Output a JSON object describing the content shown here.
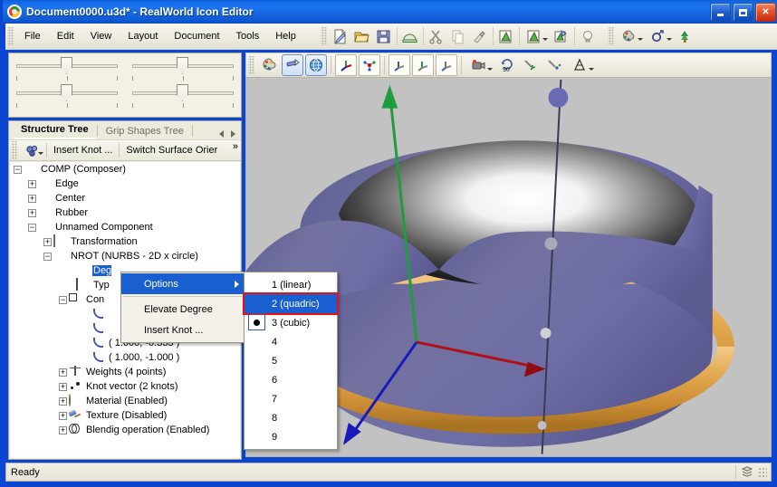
{
  "window": {
    "title": "Document0000.u3d* - RealWorld Icon Editor",
    "app_icon": "realworld-logo-icon",
    "minimize_label": "Minimize",
    "maximize_label": "Maximize",
    "close_label": "Close",
    "close_glyph": "✕"
  },
  "menubar": {
    "items": [
      {
        "label": "File"
      },
      {
        "label": "Edit"
      },
      {
        "label": "View"
      },
      {
        "label": "Layout"
      },
      {
        "label": "Document"
      },
      {
        "label": "Tools"
      },
      {
        "label": "Help"
      }
    ],
    "toolbar_icons": [
      {
        "name": "new-document-icon"
      },
      {
        "name": "open-folder-icon"
      },
      {
        "name": "save-disk-icon"
      },
      {
        "name": "export-icon"
      },
      {
        "name": "cut-scissors-icon"
      },
      {
        "name": "copy-icon"
      },
      {
        "name": "paste-brush-icon"
      },
      {
        "name": "new-image-icon"
      },
      {
        "name": "new-image-dropdown-icon"
      },
      {
        "name": "import-image-icon"
      },
      {
        "name": "lightbulb-icon"
      },
      {
        "name": "color-palette-dropdown-icon"
      },
      {
        "name": "add-object-dropdown-icon"
      },
      {
        "name": "tree-object-icon"
      }
    ]
  },
  "sliders": {
    "name": "view-rotation-sliders",
    "items": [
      {
        "name": "slider-top-left",
        "value": 50
      },
      {
        "name": "slider-top-right",
        "value": 50
      },
      {
        "name": "slider-bottom-left",
        "value": 50
      },
      {
        "name": "slider-bottom-right",
        "value": 50
      }
    ]
  },
  "treepane": {
    "tabs": [
      {
        "label": "Structure Tree",
        "active": true
      },
      {
        "label": "Grip Shapes Tree",
        "active": false
      }
    ],
    "nav_prev": "◁",
    "nav_next": "▷",
    "toolbar": {
      "dropdown_icon": "object-dropdown-icon",
      "buttons": [
        {
          "label": "Insert Knot ..."
        },
        {
          "label": "Switch Surface Orier"
        }
      ],
      "overflow": "»"
    },
    "rows": [
      {
        "indent": 0,
        "expander": "-",
        "icon": "composer-icon",
        "label": "COMP (Composer)",
        "selected": false
      },
      {
        "indent": 1,
        "expander": "+",
        "icon": "torus-icon",
        "label": "Edge",
        "selected": false
      },
      {
        "indent": 1,
        "expander": "+",
        "icon": "torus-icon",
        "label": "Center",
        "selected": false
      },
      {
        "indent": 1,
        "expander": "+",
        "icon": "torus-icon",
        "label": "Rubber",
        "selected": false
      },
      {
        "indent": 1,
        "expander": "-",
        "icon": "torus-icon",
        "label": "Unnamed Component",
        "selected": false
      },
      {
        "indent": 2,
        "expander": "+",
        "icon": "transformation-icon",
        "label": "Transformation",
        "selected": false
      },
      {
        "indent": 2,
        "expander": "-",
        "icon": "nrot-icon",
        "label": "NROT (NURBS - 2D x circle)",
        "selected": false
      },
      {
        "indent": 3,
        "expander": "",
        "icon": "degree-icon",
        "label": "Deg",
        "selected": true
      },
      {
        "indent": 3,
        "expander": "",
        "icon": "type-icon",
        "label": "Typ",
        "selected": false
      },
      {
        "indent": 3,
        "expander": "-",
        "icon": "control-points-icon",
        "label": "Con",
        "selected": false
      },
      {
        "indent": 4,
        "expander": "",
        "icon": "curve-point-icon",
        "label": "",
        "selected": false
      },
      {
        "indent": 4,
        "expander": "",
        "icon": "curve-point-icon",
        "label": "",
        "selected": false
      },
      {
        "indent": 4,
        "expander": "",
        "icon": "curve-point-icon",
        "label": "( 1.000, -0.333 )",
        "selected": false
      },
      {
        "indent": 4,
        "expander": "",
        "icon": "curve-point-icon",
        "label": "( 1.000, -1.000 )",
        "selected": false
      },
      {
        "indent": 2,
        "expander": "+",
        "icon": "weights-icon",
        "label": "Weights (4 points)",
        "selected": false
      },
      {
        "indent": 2,
        "expander": "+",
        "icon": "knot-vector-icon",
        "label": "Knot vector (2 knots)",
        "selected": false
      },
      {
        "indent": 2,
        "expander": "+",
        "icon": "material-icon",
        "label": "Material (Enabled)",
        "selected": false
      },
      {
        "indent": 2,
        "expander": "+",
        "icon": "texture-icon",
        "label": "Texture (Disabled)",
        "selected": false
      },
      {
        "indent": 2,
        "expander": "+",
        "icon": "blending-icon",
        "label": "Blendig operation (Enabled)",
        "selected": false
      }
    ]
  },
  "viewport_toolbar": {
    "icons": [
      {
        "name": "palette-icon",
        "state": "flat"
      },
      {
        "name": "light-torch-icon",
        "state": "on"
      },
      {
        "name": "globe-icon",
        "state": "on"
      },
      {
        "name": "axis-gizmo-icon",
        "state": "frame"
      },
      {
        "name": "points-gizmo-icon",
        "state": "frame"
      },
      {
        "name": "move-axis-icon",
        "state": "frame"
      },
      {
        "name": "scale-axis-icon",
        "state": "frame"
      },
      {
        "name": "rotate-axis-icon",
        "state": "frame"
      },
      {
        "name": "camera-dropdown-icon",
        "state": "dd"
      },
      {
        "name": "rotate-90-icon",
        "state": "flat"
      },
      {
        "name": "pick-axis-icon",
        "state": "flat"
      },
      {
        "name": "pick-point-icon",
        "state": "flat"
      },
      {
        "name": "cone-dropdown-icon",
        "state": "dd"
      }
    ]
  },
  "scene": {
    "name": "3d-nurbs-preview",
    "background_color": "#c2c2c2",
    "surface_color": "#6f6ea8",
    "surface_inner_color": "#ffffff",
    "ring_color": "#e0a84e",
    "axis_x_color": "#b01018",
    "axis_y_color": "#1f9c3c",
    "axis_z_color": "#1a1ab8",
    "handle_color": "#6a6ab4"
  },
  "contextmenu": {
    "items": [
      {
        "label": "Options",
        "highlighted": true,
        "has_submenu": true,
        "icon": "options-icon"
      },
      {
        "label": "Elevate Degree",
        "highlighted": false,
        "has_submenu": false,
        "icon": ""
      },
      {
        "label": "Insert Knot ...",
        "highlighted": false,
        "has_submenu": false,
        "icon": ""
      }
    ]
  },
  "submenu": {
    "name": "degree-submenu",
    "items": [
      {
        "label": "1 (linear)",
        "selected": false,
        "focused": false
      },
      {
        "label": "2 (quadric)",
        "selected": false,
        "focused": true
      },
      {
        "label": "3 (cubic)",
        "selected": true,
        "focused": false
      },
      {
        "label": "4",
        "selected": false,
        "focused": false
      },
      {
        "label": "5",
        "selected": false,
        "focused": false
      },
      {
        "label": "6",
        "selected": false,
        "focused": false
      },
      {
        "label": "7",
        "selected": false,
        "focused": false
      },
      {
        "label": "8",
        "selected": false,
        "focused": false
      },
      {
        "label": "9",
        "selected": false,
        "focused": false
      }
    ]
  },
  "statusbar": {
    "text": "Ready",
    "resize_grip": "resize-grip-icon",
    "indicator_icon": "layers-icon"
  },
  "colors": {
    "titlebar_blue": "#1b74ee",
    "selection_blue": "#1a5fd0",
    "focus_red": "#e81010",
    "panel_beige": "#ece9dd"
  }
}
